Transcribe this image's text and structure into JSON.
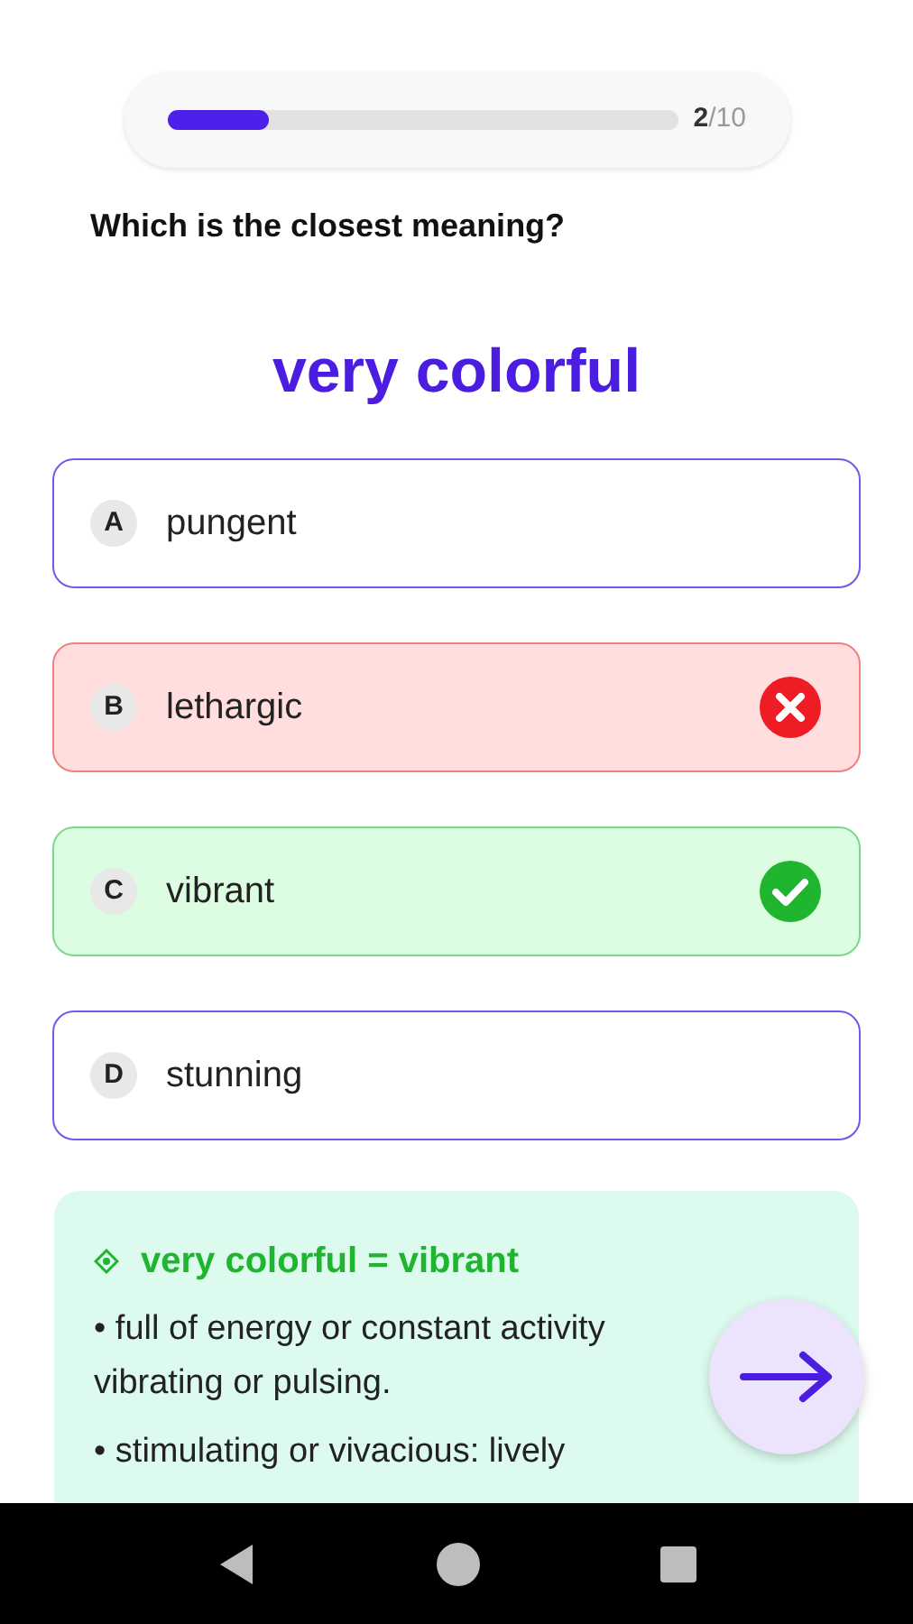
{
  "progress": {
    "level": 0.2,
    "current": "2",
    "total": "/10"
  },
  "question": "Which is the closest meaning?",
  "word": "very colorful",
  "options": [
    {
      "letter": "A",
      "text": "pungent",
      "kind": "neutral"
    },
    {
      "letter": "B",
      "text": "lethargic",
      "kind": "wrong"
    },
    {
      "letter": "C",
      "text": "vibrant",
      "kind": "correct"
    },
    {
      "letter": "D",
      "text": "stunning",
      "kind": "neutral"
    }
  ],
  "explanation": {
    "title": "very colorful = vibrant",
    "definitions": [
      "• full of energy or constant activity vibrating or pulsing.",
      "• stimulating or vivacious: lively"
    ]
  },
  "nav_bar": {
    "buttons": [
      {
        "kind": "back"
      },
      {
        "kind": "home"
      },
      {
        "kind": "recents"
      }
    ]
  }
}
